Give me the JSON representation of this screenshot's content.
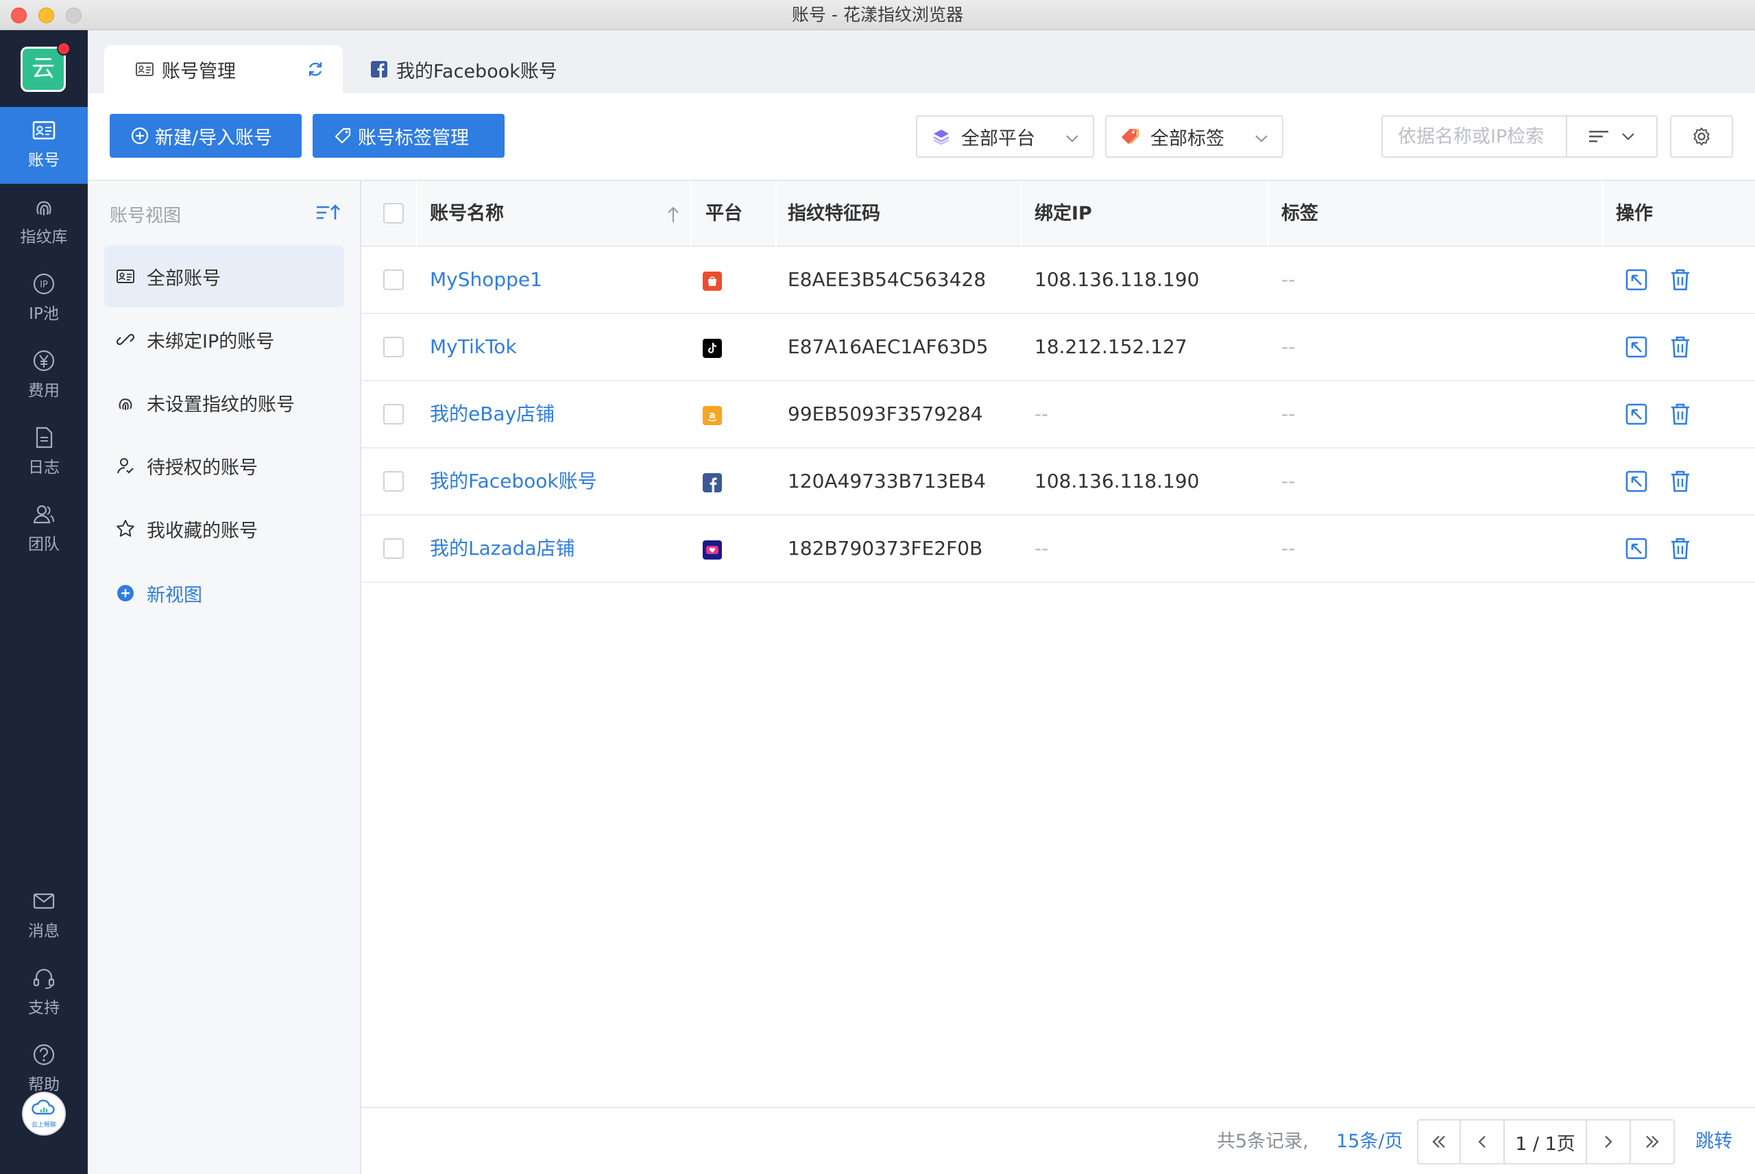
{
  "window": {
    "title": "账号 - 花漾指纹浏览器"
  },
  "app": {
    "logo_char": "云",
    "avatar_text": "云上畅聊"
  },
  "nav": {
    "items": [
      {
        "label": "账号",
        "icon": "account-card-icon"
      },
      {
        "label": "指纹库",
        "icon": "fingerprint-icon"
      },
      {
        "label": "IP池",
        "icon": "ip-icon"
      },
      {
        "label": "费用",
        "icon": "yen-icon"
      },
      {
        "label": "日志",
        "icon": "document-icon"
      },
      {
        "label": "团队",
        "icon": "team-icon"
      }
    ],
    "bottom_items": [
      {
        "label": "消息",
        "icon": "mail-icon"
      },
      {
        "label": "支持",
        "icon": "headset-icon"
      },
      {
        "label": "帮助",
        "icon": "help-icon"
      }
    ]
  },
  "tabs": [
    {
      "label": "账号管理"
    },
    {
      "label": "我的Facebook账号"
    }
  ],
  "toolbar": {
    "new_import_label": "新建/导入账号",
    "tag_manage_label": "账号标签管理",
    "platform_select": "全部平台",
    "tag_select": "全部标签",
    "search_placeholder": "依据名称或IP检索"
  },
  "views": {
    "heading": "账号视图",
    "items": [
      {
        "label": "全部账号"
      },
      {
        "label": "未绑定IP的账号"
      },
      {
        "label": "未设置指纹的账号"
      },
      {
        "label": "待授权的账号"
      },
      {
        "label": "我收藏的账号"
      }
    ],
    "new_view_label": "新视图"
  },
  "table": {
    "columns": [
      "账号名称",
      "平台",
      "指纹特征码",
      "绑定IP",
      "标签",
      "操作"
    ],
    "rows": [
      {
        "name": "MyShoppe1",
        "platform": "shopee",
        "fingerprint": "E8AEE3B54C563428",
        "ip": "108.136.118.190",
        "tag": "--"
      },
      {
        "name": "MyTikTok",
        "platform": "tiktok",
        "fingerprint": "E87A16AEC1AF63D5",
        "ip": "18.212.152.127",
        "tag": "--"
      },
      {
        "name": "我的eBay店铺",
        "platform": "amazon",
        "fingerprint": "99EB5093F3579284",
        "ip": "--",
        "tag": "--"
      },
      {
        "name": "我的Facebook账号",
        "platform": "facebook",
        "fingerprint": "120A49733B713EB4",
        "ip": "108.136.118.190",
        "tag": "--"
      },
      {
        "name": "我的Lazada店铺",
        "platform": "lazada",
        "fingerprint": "182B790373FE2F0B",
        "ip": "--",
        "tag": "--"
      }
    ]
  },
  "pagination": {
    "total_text": "共5条记录,",
    "page_size": "15条/页",
    "page_indicator": "1 / 1页",
    "jump_label": "跳转"
  },
  "colors": {
    "primary": "#2f7de1",
    "nav_bg": "#1c2438",
    "shopee": "#ee4d2d",
    "tiktok": "#000000",
    "amazon": "#f5a623",
    "facebook": "#3b5998",
    "lazada": "#1a1a8c"
  }
}
